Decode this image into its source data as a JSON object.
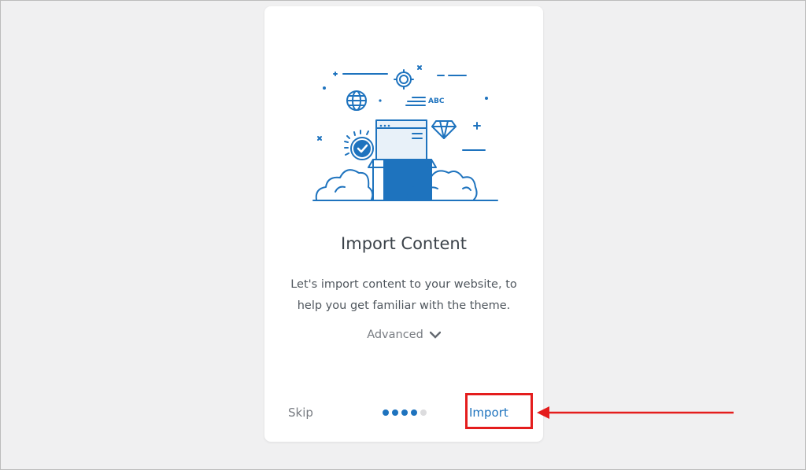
{
  "card": {
    "title": "Import Content",
    "description": "Let's import content to your website, to help you get familiar with the theme.",
    "advanced_label": "Advanced",
    "advanced_icon": "chevron-down-icon"
  },
  "illustration": {
    "badge_text": "ABC",
    "icons": [
      "plus-icon",
      "gear-icon",
      "globe-icon",
      "diamond-icon",
      "check-badge-icon",
      "browser-window-icon",
      "box-icon",
      "cloud-icon"
    ]
  },
  "footer": {
    "skip_label": "Skip",
    "import_label": "Import",
    "steps_total": 5,
    "steps_active": 4
  },
  "colors": {
    "accent": "#1e73be",
    "annotation": "#e41d1d",
    "background": "#f0f0f1",
    "card": "#ffffff"
  }
}
